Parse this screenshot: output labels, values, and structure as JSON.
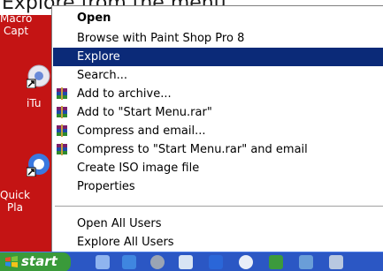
{
  "caption": {
    "text": "Explore from the menu."
  },
  "desktop": {
    "icons": [
      {
        "label_line1": "Macro",
        "label_line2": "Capt"
      },
      {
        "label": "iTu"
      },
      {
        "label_line1": "Quick",
        "label_line2": "Pla"
      }
    ]
  },
  "menu": {
    "items": [
      {
        "label": "Open",
        "bold": true,
        "icon": "none"
      },
      {
        "label": "Browse with Paint Shop Pro 8",
        "icon": "none"
      },
      {
        "label": "Explore",
        "selected": true,
        "icon": "none"
      },
      {
        "label": "Search...",
        "icon": "none"
      },
      {
        "label": "Add to archive...",
        "icon": "winrar-icon"
      },
      {
        "label": "Add to \"Start Menu.rar\"",
        "icon": "winrar-icon"
      },
      {
        "label": "Compress and email...",
        "icon": "winrar-icon"
      },
      {
        "label": "Compress to \"Start Menu.rar\" and email",
        "icon": "winrar-icon"
      },
      {
        "label": "Create ISO image file",
        "icon": "none"
      },
      {
        "label": "Properties",
        "icon": "none"
      },
      {
        "label": "Open All Users",
        "icon": "none"
      },
      {
        "label": "Explore All Users",
        "icon": "none"
      }
    ]
  },
  "taskbar": {
    "start_label": "start"
  },
  "colors": {
    "menu_highlight": "#0b2a78",
    "desktop_bg": "#c41414",
    "taskbar_bg": "#2b57c4",
    "start_button": "#3a9a3a"
  }
}
